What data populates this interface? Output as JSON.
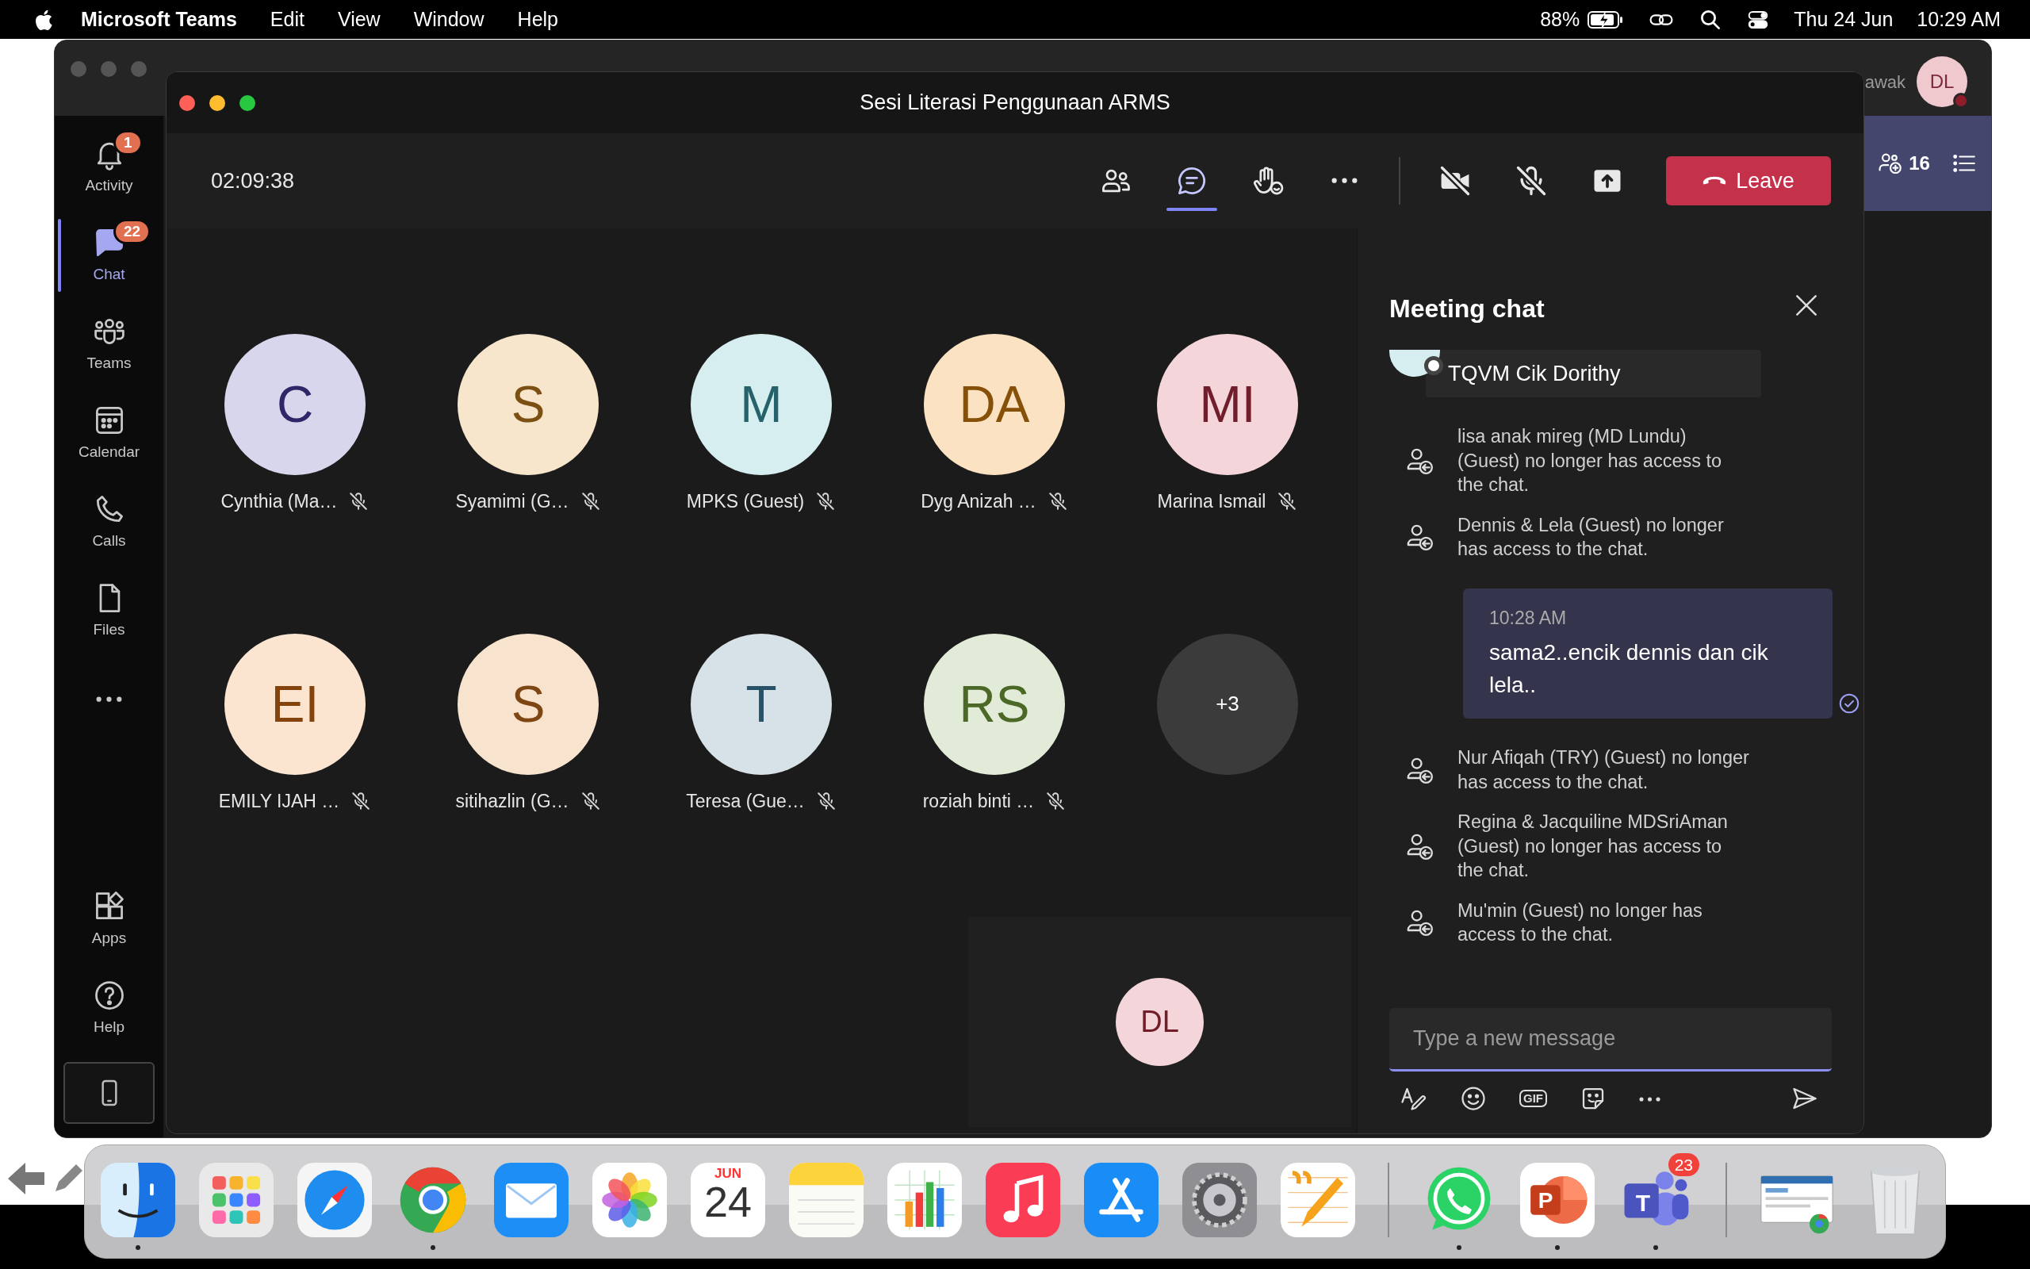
{
  "menubar": {
    "app": "Microsoft Teams",
    "menus": [
      "Edit",
      "View",
      "Window",
      "Help"
    ],
    "battery": "88%",
    "charging": true,
    "date": "Thu 24 Jun",
    "time": "10:29 AM"
  },
  "teams_window": {
    "rail": [
      {
        "kind": "activity",
        "label": "Activity",
        "badge": "1",
        "selected": false
      },
      {
        "kind": "chat",
        "label": "Chat",
        "badge": "22",
        "selected": true
      },
      {
        "kind": "teams",
        "label": "Teams",
        "selected": false
      },
      {
        "kind": "calendar",
        "label": "Calendar",
        "selected": false
      },
      {
        "kind": "calls",
        "label": "Calls",
        "selected": false
      },
      {
        "kind": "files",
        "label": "Files",
        "selected": false
      }
    ],
    "rail_bottom": [
      {
        "kind": "apps",
        "label": "Apps"
      },
      {
        "kind": "help",
        "label": "Help"
      }
    ],
    "user_name": "awak",
    "user_initials": "DL",
    "participant_count": "16"
  },
  "meeting": {
    "title": "Sesi Literasi Penggunaan ARMS",
    "timer": "02:09:38",
    "toolbar": [
      {
        "kind": "people",
        "selected": false
      },
      {
        "kind": "chat",
        "selected": true
      },
      {
        "kind": "raise-hand",
        "selected": false
      },
      {
        "kind": "more",
        "selected": false
      }
    ],
    "devices": [
      {
        "kind": "camera",
        "on": false
      },
      {
        "kind": "mic",
        "on": false
      },
      {
        "kind": "share"
      }
    ],
    "leave": "Leave",
    "participants": [
      {
        "initials": "C",
        "name": "Cynthia (Ma…",
        "color": "#d8d6ec",
        "muted": true
      },
      {
        "initials": "S",
        "name": "Syamimi (G…",
        "color": "#f7e5cc",
        "muted": true
      },
      {
        "initials": "M",
        "name": "MPKS (Guest)",
        "color": "#d7eef1",
        "muted": true
      },
      {
        "initials": "DA",
        "name": "Dyg Anizah …",
        "color": "#fbe2c2",
        "muted": true
      },
      {
        "initials": "MI",
        "name": "Marina Ismail",
        "color": "#f4d5da",
        "muted": true
      },
      {
        "initials": "EI",
        "name": "EMILY IJAH …",
        "color": "#fbe4d0",
        "muted": true
      },
      {
        "initials": "S",
        "name": "sitihazlin (G…",
        "color": "#f8e3cf",
        "muted": true
      },
      {
        "initials": "T",
        "name": "Teresa (Gue…",
        "color": "#d6e2e8",
        "muted": true
      },
      {
        "initials": "RS",
        "name": "roziah binti …",
        "color": "#e2ead8",
        "muted": true
      }
    ],
    "overflow": "+3",
    "self": {
      "initials": "DL",
      "color": "#f4d6da"
    },
    "chat": {
      "title": "Meeting chat",
      "pinned": {
        "text": "TQVM Cik Dorithy",
        "color": "#d7eef1"
      },
      "messages": [
        {
          "kind": "system",
          "text": "lisa anak mireg (MD Lundu) (Guest) no longer has access to the chat."
        },
        {
          "kind": "system",
          "text": "Dennis & Lela (Guest) no longer has access to the chat."
        },
        {
          "kind": "own",
          "time": "10:28 AM",
          "text": "sama2..encik dennis dan cik lela..",
          "read": true
        },
        {
          "kind": "system",
          "text": "Nur Afiqah (TRY) (Guest) no longer has access to the chat."
        },
        {
          "kind": "system",
          "text": "Regina & Jacquiline MDSriAman (Guest) no longer has access to the chat."
        },
        {
          "kind": "system",
          "text": "Mu'min (Guest) no longer has access to the chat."
        }
      ],
      "composer": {
        "placeholder": "Type a new message",
        "focused": true
      },
      "tools": [
        {
          "kind": "format"
        },
        {
          "kind": "emoji"
        },
        {
          "kind": "gif",
          "label": "GIF"
        },
        {
          "kind": "sticker"
        },
        {
          "kind": "more"
        }
      ]
    }
  },
  "dock": {
    "groups": [
      [
        {
          "kind": "finder",
          "running": true
        },
        {
          "kind": "launchpad",
          "running": false
        },
        {
          "kind": "safari",
          "running": false
        },
        {
          "kind": "chrome",
          "running": true
        },
        {
          "kind": "mail",
          "running": false
        },
        {
          "kind": "photos",
          "running": false
        },
        {
          "kind": "calendar",
          "month": "JUN",
          "day": "24",
          "running": false
        },
        {
          "kind": "notes",
          "running": false
        },
        {
          "kind": "numbers",
          "running": false
        },
        {
          "kind": "music",
          "running": false
        },
        {
          "kind": "appstore",
          "running": false
        },
        {
          "kind": "settings",
          "running": false
        },
        {
          "kind": "pages",
          "running": false
        }
      ],
      [
        {
          "kind": "whatsapp",
          "running": true
        },
        {
          "kind": "powerpoint",
          "letter": "P",
          "running": true
        },
        {
          "kind": "teams",
          "letter": "T",
          "badge": "23",
          "running": true
        }
      ],
      [
        {
          "kind": "thumbnail",
          "running": false
        },
        {
          "kind": "trash",
          "running": false
        }
      ]
    ]
  }
}
